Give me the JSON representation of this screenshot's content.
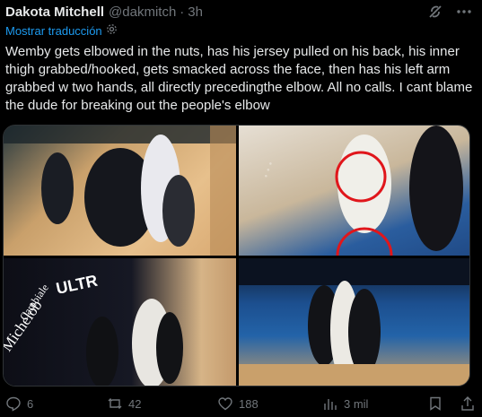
{
  "post": {
    "author_name": "Dakota Mitchell",
    "author_handle": "@dakmitch",
    "separator": "·",
    "time": "3h",
    "translate_label": "Mostrar traducción",
    "text": "Wemby gets elbowed in the nuts, has his jersey pulled on his back, his inner thigh grabbed/hooked, gets smacked across the face,  then has his left arm grabbed w two hands, all directly precedingthe elbow. All no calls. I cant blame the dude for breaking out the people's elbow"
  },
  "header_icons": [
    "grok-icon",
    "more-icon"
  ],
  "media": {
    "count": 4,
    "court_text": [
      "ULTR",
      "Michelob",
      "Cambiale"
    ]
  },
  "actions": {
    "replies": "6",
    "reposts": "42",
    "likes": "188",
    "views": "3 mil"
  },
  "colors": {
    "background": "#000000",
    "text": "#e7e9ea",
    "muted": "#71767b",
    "accent": "#1d9bf0",
    "highlight_circle": "#e0161b"
  }
}
